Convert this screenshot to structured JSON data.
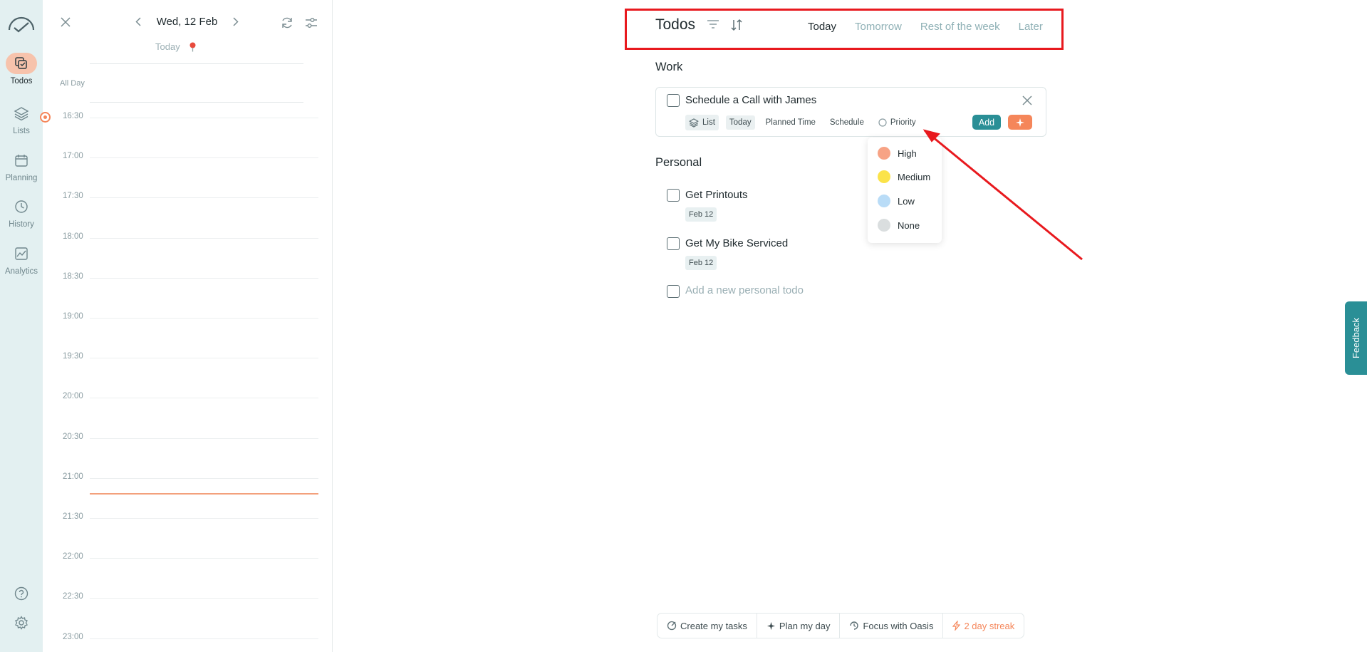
{
  "nav": {
    "items": [
      {
        "label": "Todos",
        "icon": "todos-icon"
      },
      {
        "label": "Lists",
        "icon": "layers-icon"
      },
      {
        "label": "Planning",
        "icon": "calendar-icon"
      },
      {
        "label": "History",
        "icon": "history-icon"
      },
      {
        "label": "Analytics",
        "icon": "analytics-icon"
      }
    ],
    "active": "Todos"
  },
  "calendar": {
    "date": "Wed, 12 Feb",
    "today_label": "Today",
    "all_day": "All Day",
    "hours": [
      "16:30",
      "17:00",
      "17:30",
      "18:00",
      "18:30",
      "19:00",
      "19:30",
      "20:00",
      "20:30",
      "21:00",
      "21:30",
      "22:00",
      "22:30",
      "23:00"
    ]
  },
  "main": {
    "title": "Todos",
    "tabs": [
      "Today",
      "Tomorrow",
      "Rest of the week",
      "Later"
    ],
    "active_tab": "Today",
    "work_section": "Work",
    "editor": {
      "task": "Schedule a Call with James",
      "chips": [
        "List",
        "Today",
        "Planned Time",
        "Schedule",
        "Priority"
      ],
      "add_label": "Add"
    },
    "priority_options": [
      {
        "label": "High",
        "color": "#f7a385"
      },
      {
        "label": "Medium",
        "color": "#fbe34a"
      },
      {
        "label": "Low",
        "color": "#b9dcf7"
      },
      {
        "label": "None",
        "color": "#dadedf"
      }
    ],
    "personal_section": "Personal",
    "personal_tasks": [
      {
        "title": "Get Printouts",
        "date": "Feb 12"
      },
      {
        "title": "Get My Bike Serviced",
        "date": "Feb 12"
      }
    ],
    "add_placeholder": "Add a new personal todo"
  },
  "bottom_bar": [
    "Create my tasks",
    "Plan my day",
    "Focus with Oasis",
    "2 day streak"
  ],
  "feedback": "Feedback",
  "colors": {
    "accent": "#2a8f96",
    "orange": "#f5865a",
    "annotation": "#e8191e"
  }
}
